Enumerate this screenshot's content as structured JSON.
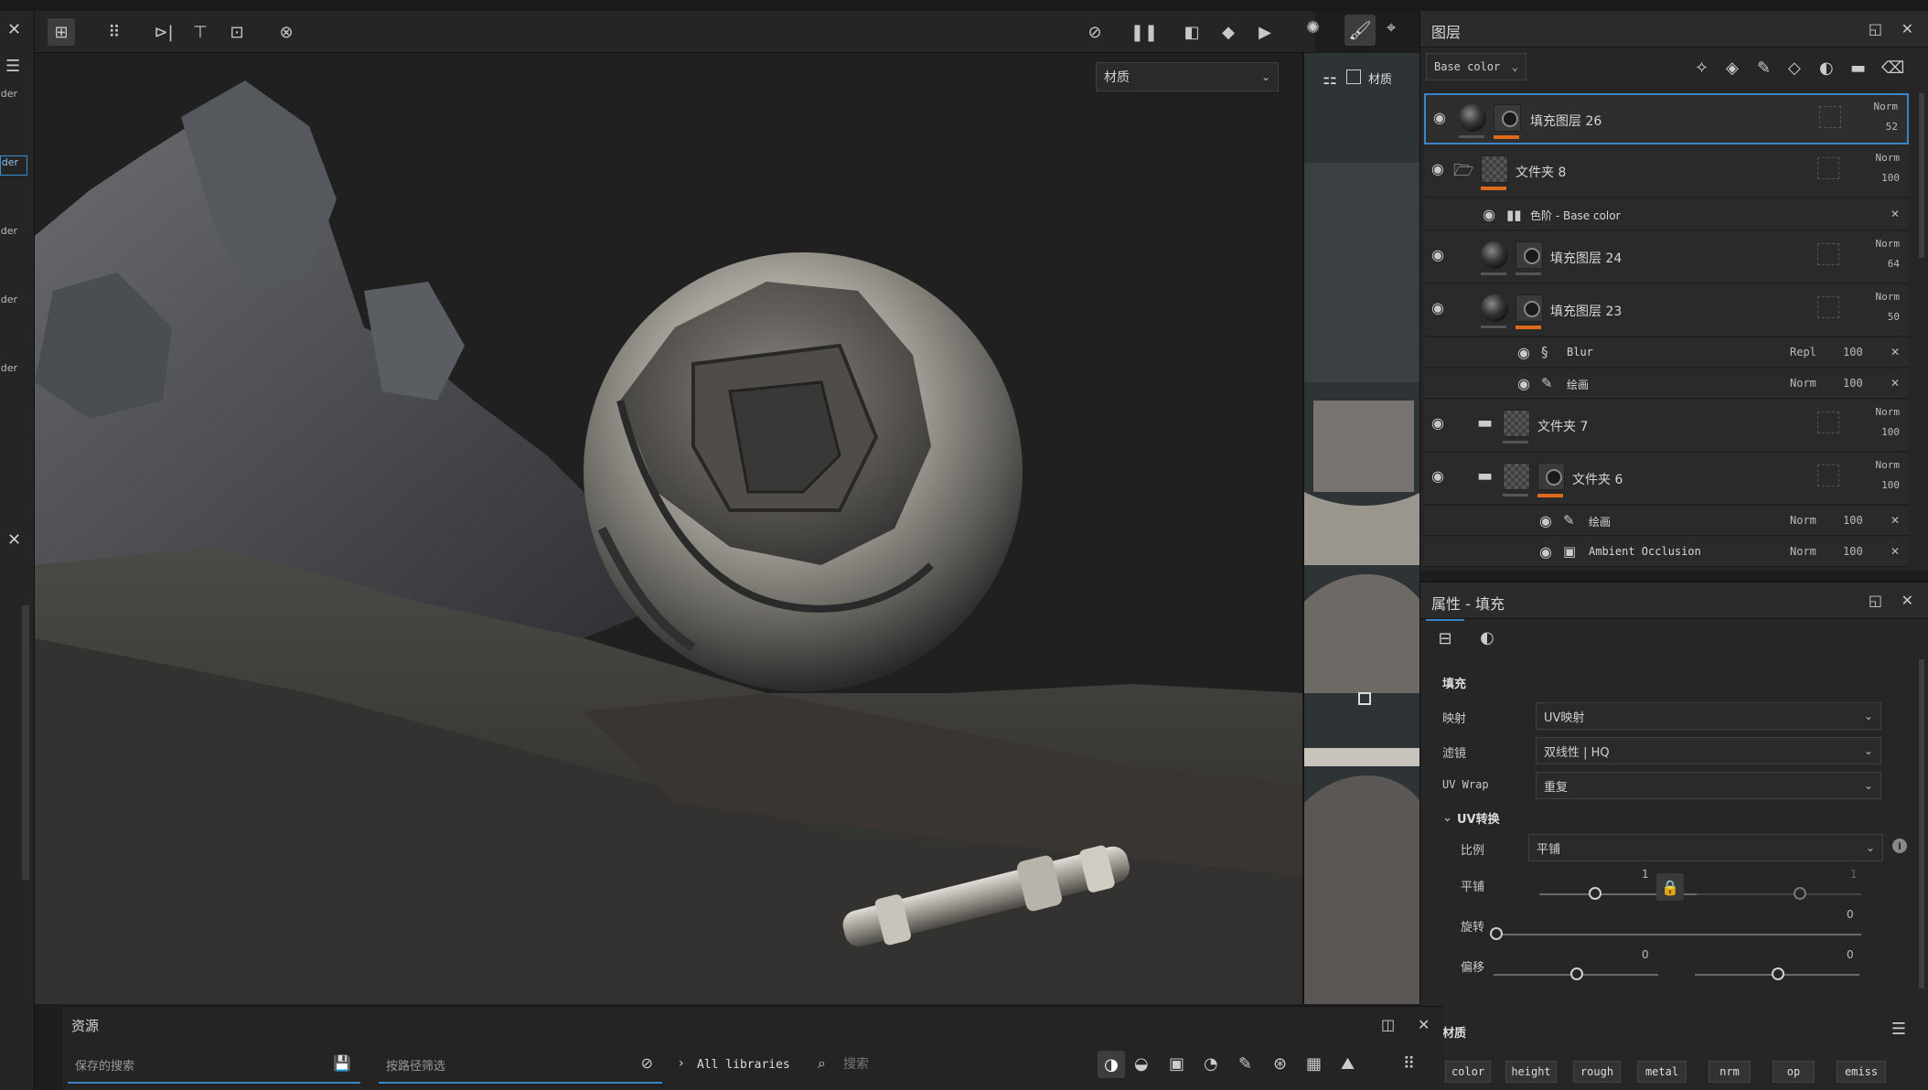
{
  "toolbar": {
    "left_icons": [
      "select-grid-icon",
      "grid-3x3-icon",
      "mirror-x-icon",
      "mirror-y-icon",
      "frame-add-icon",
      "clock-reset-icon"
    ],
    "right_icons": [
      "hide-icon",
      "pause-icon",
      "symmetry-icon",
      "cube-icon",
      "camera-icon",
      "particles-icon",
      "paint-brush-icon",
      "screenshot-icon"
    ]
  },
  "viewport": {
    "material_select": "材质",
    "uv_label": "材质"
  },
  "left_strip": {
    "labels": [
      "ader",
      "ader",
      "ader",
      "ader",
      "ader"
    ]
  },
  "layers": {
    "title": "图层",
    "channel_select": "Base color",
    "rows": [
      {
        "name": "填充图层 26",
        "blend": "Norm",
        "opacity": "52"
      },
      {
        "name": "文件夹 8",
        "blend": "Norm",
        "opacity": "100"
      },
      {
        "name": "色阶 - Base color"
      },
      {
        "name": "填充图层 24",
        "blend": "Norm",
        "opacity": "64"
      },
      {
        "name": "填充图层 23",
        "blend": "Norm",
        "opacity": "50"
      },
      {
        "name": "Blur",
        "blend": "Repl",
        "opacity": "100"
      },
      {
        "name": "绘画",
        "blend": "Norm",
        "opacity": "100"
      },
      {
        "name": "文件夹 7",
        "blend": "Norm",
        "opacity": "100"
      },
      {
        "name": "文件夹 6",
        "blend": "Norm",
        "opacity": "100"
      },
      {
        "name": "绘画",
        "blend": "Norm",
        "opacity": "100"
      },
      {
        "name": "Ambient Occlusion",
        "blend": "Norm",
        "opacity": "100"
      }
    ]
  },
  "properties": {
    "title": "属性 - 填充",
    "section_fill": "填充",
    "mapping_label": "映射",
    "mapping_value": "UV映射",
    "filter_label": "滤镜",
    "filter_value": "双线性 | HQ",
    "uvwrap_label": "UV Wrap",
    "uvwrap_value": "重复",
    "uv_transform": "UV转换",
    "scale_label": "比例",
    "scale_value": "平铺",
    "tile_label": "平铺",
    "tile_value_1": "1",
    "tile_value_2": "1",
    "rotation_label": "旋转",
    "rotation_value": "0",
    "offset_label": "偏移",
    "offset_value_1": "0",
    "offset_value_2": "0",
    "material_section": "材质",
    "channels": [
      "color",
      "height",
      "rough",
      "metal",
      "nrm",
      "op",
      "emiss"
    ]
  },
  "assets": {
    "title": "资源",
    "saved_search": "保存的搜索",
    "path_filter": "按路径筛选",
    "libraries": "All libraries",
    "search_placeholder": "搜索"
  }
}
